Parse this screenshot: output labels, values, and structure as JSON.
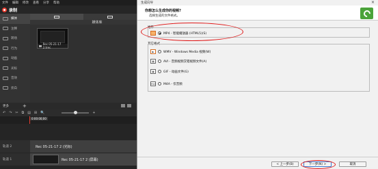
{
  "editor": {
    "menu": [
      "文件",
      "编辑",
      "修改",
      "查看",
      "分享",
      "帮助"
    ],
    "record_label": "录制",
    "sidebar": [
      "媒体",
      "注释",
      "转场",
      "行为",
      "动画",
      "光标",
      "音效",
      "旁白"
    ],
    "more_label": "更多",
    "media_library_title": "媒体库",
    "clip_name": "Rec 05-21-17 2.trec",
    "playhead_time": "0:00:00;00",
    "tracks": [
      {
        "label": "轨道 2",
        "clip": "Rec 05-21-17 2 (光标)"
      },
      {
        "label": "轨道 1",
        "clip": "Rec 05-21-17 2 (屏幕)"
      }
    ]
  },
  "wizard": {
    "title": "生成向导",
    "close": "×",
    "question": "你想怎么生成你的视频?",
    "subtitle": "选择生成的文件格式。",
    "group_recommended": "推荐",
    "group_other": "其它格式",
    "options": {
      "mp4": "MP4 - 智能播放器 (HTML5)(S)",
      "wmv": "WMV - Windows Media 视频(W)",
      "avi": "AVI - 音频视频交错视频文件(A)",
      "gif": "GIF - 动画文件(G)",
      "m4a": "M4A - 仅音频"
    },
    "icons": {
      "mp4": "mp4-icon",
      "wmv": "wmv-icon",
      "avi": "avi-icon",
      "gif": "gif-icon",
      "m4a": "m4a-icon"
    },
    "m4a_icon_text": "M4A",
    "back": "< 上一步(B)",
    "next": "下一步(N) >",
    "cancel": "取消",
    "selected": "mp4"
  },
  "colors": {
    "accent": "#4ba33a",
    "annotation": "#e01818",
    "record": "#e63b2e"
  }
}
